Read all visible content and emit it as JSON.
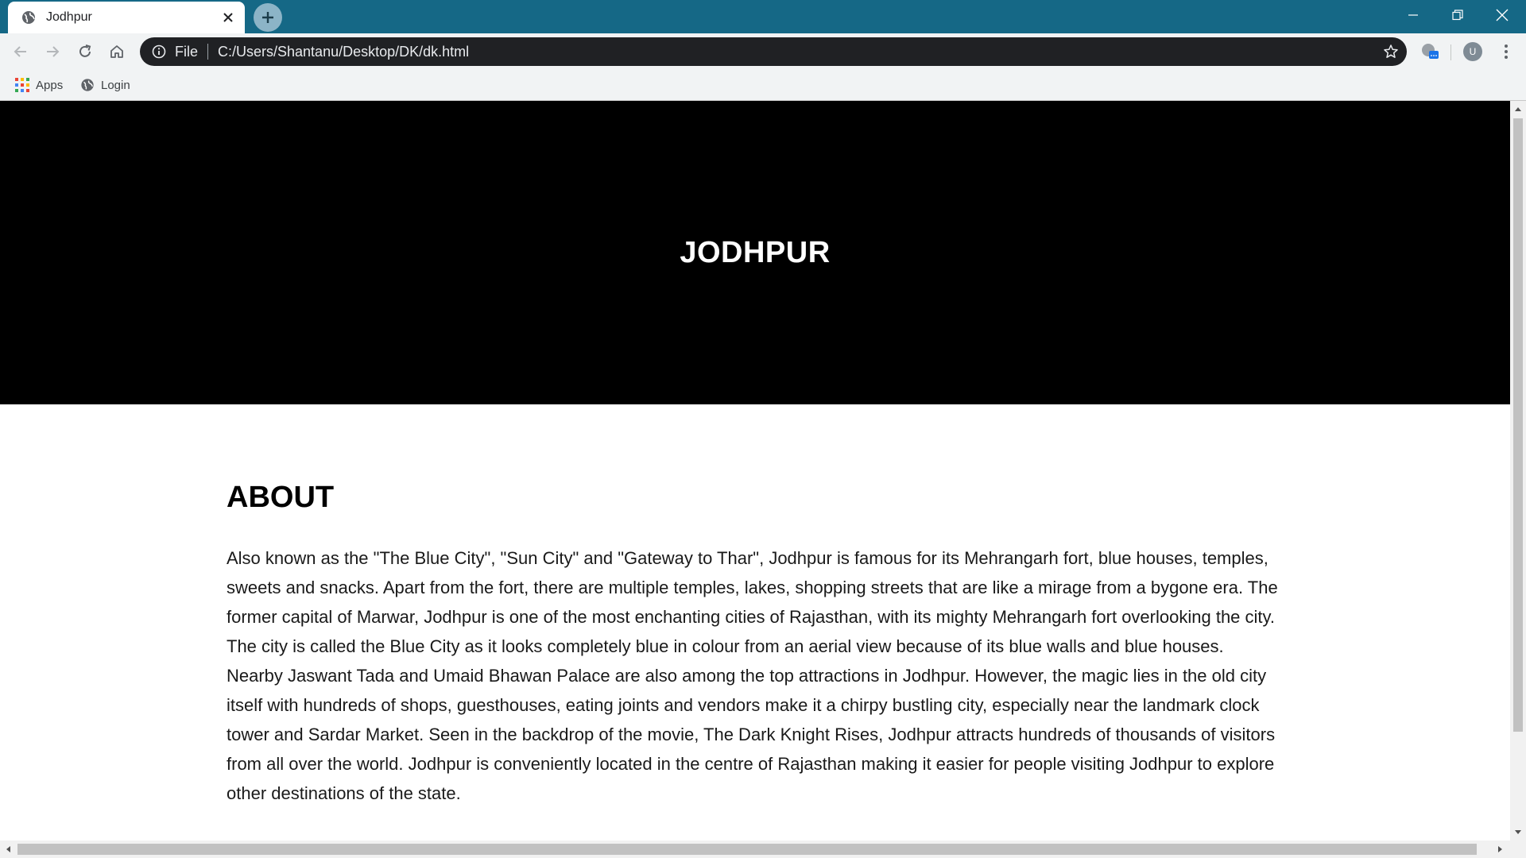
{
  "browser": {
    "tab": {
      "title": "Jodhpur",
      "favicon": "globe-icon"
    },
    "omnibox": {
      "scheme_label": "File",
      "url": "C:/Users/Shantanu/Desktop/DK/dk.html"
    },
    "profile_initial": "U",
    "bookmarks": [
      {
        "label": "Apps",
        "icon": "apps-grid-icon"
      },
      {
        "label": "Login",
        "icon": "globe-icon"
      }
    ],
    "colors": {
      "tabstrip": "#156886",
      "toolbar": "#f1f3f4",
      "omnibox": "#202124"
    }
  },
  "page": {
    "hero_title": "JODHPUR",
    "about_heading": "ABOUT",
    "about_text": "Also known as the \"The Blue City\", \"Sun City\" and \"Gateway to Thar\", Jodhpur is famous for its Mehrangarh fort, blue houses, temples, sweets and snacks. Apart from the fort, there are multiple temples, lakes, shopping streets that are like a mirage from a bygone era. The former capital of Marwar, Jodhpur is one of the most enchanting cities of Rajasthan, with its mighty Mehrangarh fort overlooking the city. The city is called the Blue City as it looks completely blue in colour from an aerial view because of its blue walls and blue houses. Nearby Jaswant Tada and Umaid Bhawan Palace are also among the top attractions in Jodhpur. However, the magic lies in the old city itself with hundreds of shops, guesthouses, eating joints and vendors make it a chirpy bustling city, especially near the landmark clock tower and Sardar Market. Seen in the backdrop of the movie, The Dark Knight Rises, Jodhpur attracts hundreds of thousands of visitors from all over the world. Jodhpur is conveniently located in the centre of Rajasthan making it easier for people visiting Jodhpur to explore other destinations of the state.",
    "colors": {
      "hero_bg": "#000000",
      "hero_text": "#ffffff"
    }
  }
}
